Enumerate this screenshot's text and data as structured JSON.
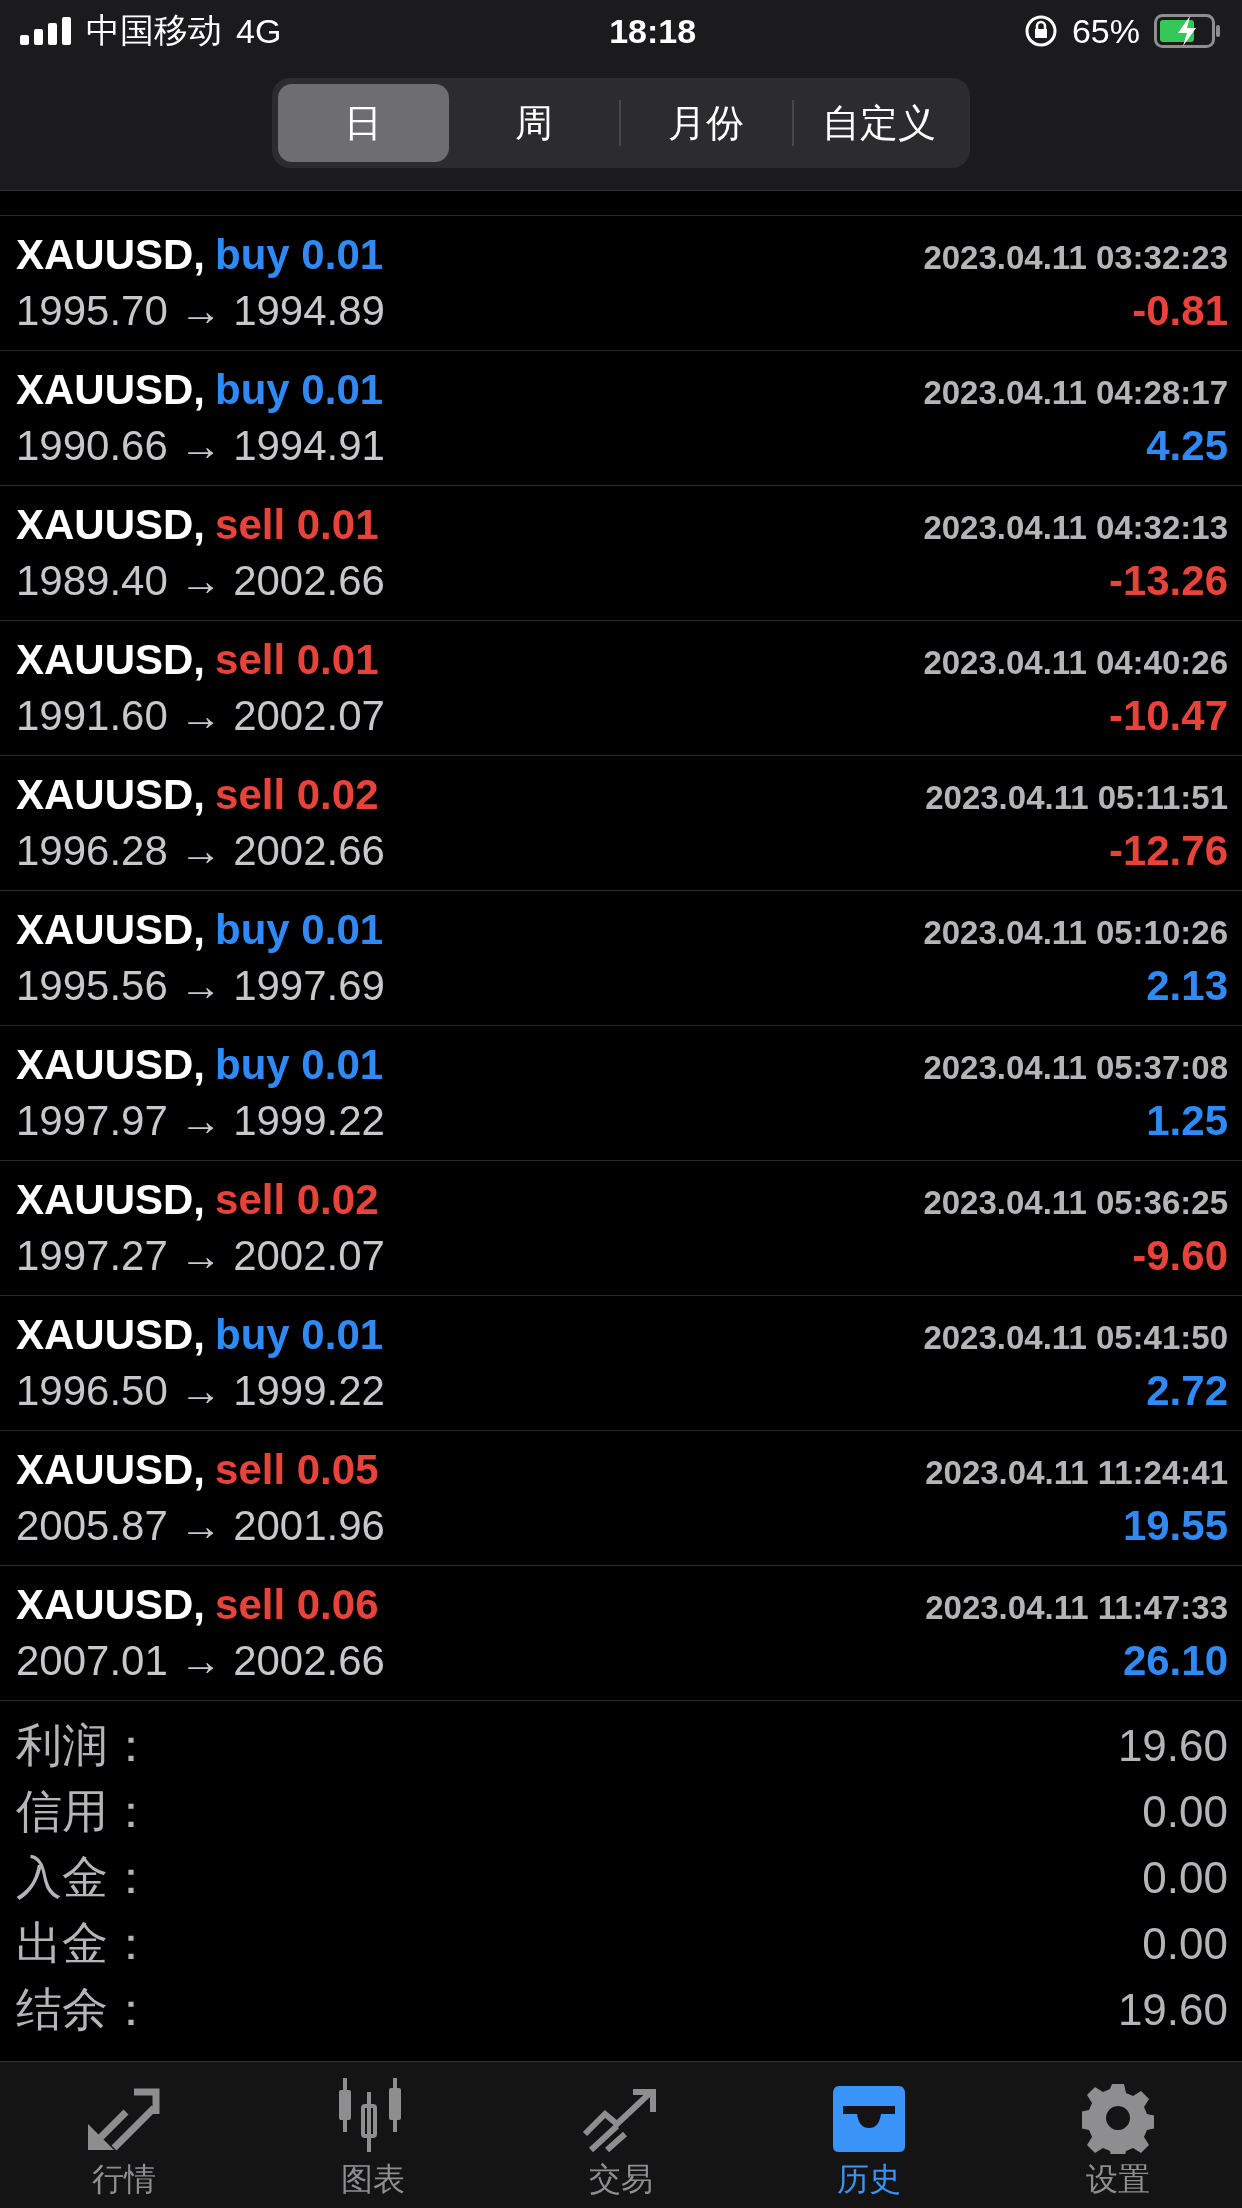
{
  "status_bar": {
    "carrier": "中国移动",
    "network": "4G",
    "time": "18:18",
    "battery": "65%"
  },
  "period_tabs": [
    {
      "label": "日",
      "selected": true
    },
    {
      "label": "周",
      "selected": false
    },
    {
      "label": "月份",
      "selected": false
    },
    {
      "label": "自定义",
      "selected": false
    }
  ],
  "deals": [
    {
      "symbol": "XAUUSD,",
      "kind": "buy",
      "order": "buy 0.01",
      "time": "2023.04.11 03:32:23",
      "prices": "1995.70 → 1994.89",
      "profit": {
        "text": "-0.81",
        "kind": "loss"
      }
    },
    {
      "symbol": "XAUUSD,",
      "kind": "buy",
      "order": "buy 0.01",
      "time": "2023.04.11 04:28:17",
      "prices": "1990.66 → 1994.91",
      "profit": {
        "text": "4.25",
        "kind": "gain"
      }
    },
    {
      "symbol": "XAUUSD,",
      "kind": "sell",
      "order": "sell 0.01",
      "time": "2023.04.11 04:32:13",
      "prices": "1989.40 → 2002.66",
      "profit": {
        "text": "-13.26",
        "kind": "loss"
      }
    },
    {
      "symbol": "XAUUSD,",
      "kind": "sell",
      "order": "sell 0.01",
      "time": "2023.04.11 04:40:26",
      "prices": "1991.60 → 2002.07",
      "profit": {
        "text": "-10.47",
        "kind": "loss"
      }
    },
    {
      "symbol": "XAUUSD,",
      "kind": "sell",
      "order": "sell 0.02",
      "time": "2023.04.11 05:11:51",
      "prices": "1996.28 → 2002.66",
      "profit": {
        "text": "-12.76",
        "kind": "loss"
      }
    },
    {
      "symbol": "XAUUSD,",
      "kind": "buy",
      "order": "buy 0.01",
      "time": "2023.04.11 05:10:26",
      "prices": "1995.56 → 1997.69",
      "profit": {
        "text": "2.13",
        "kind": "gain"
      }
    },
    {
      "symbol": "XAUUSD,",
      "kind": "buy",
      "order": "buy 0.01",
      "time": "2023.04.11 05:37:08",
      "prices": "1997.97 → 1999.22",
      "profit": {
        "text": "1.25",
        "kind": "gain"
      }
    },
    {
      "symbol": "XAUUSD,",
      "kind": "sell",
      "order": "sell 0.02",
      "time": "2023.04.11 05:36:25",
      "prices": "1997.27 → 2002.07",
      "profit": {
        "text": "-9.60",
        "kind": "loss"
      }
    },
    {
      "symbol": "XAUUSD,",
      "kind": "buy",
      "order": "buy 0.01",
      "time": "2023.04.11 05:41:50",
      "prices": "1996.50 → 1999.22",
      "profit": {
        "text": "2.72",
        "kind": "gain"
      }
    },
    {
      "symbol": "XAUUSD,",
      "kind": "sell",
      "order": "sell 0.05",
      "time": "2023.04.11 11:24:41",
      "prices": "2005.87 → 2001.96",
      "profit": {
        "text": "19.55",
        "kind": "gain"
      }
    },
    {
      "symbol": "XAUUSD,",
      "kind": "sell",
      "order": "sell 0.06",
      "time": "2023.04.11 11:47:33",
      "prices": "2007.01 → 2002.66",
      "profit": {
        "text": "26.10",
        "kind": "gain"
      }
    }
  ],
  "summary": [
    {
      "label": "利润：",
      "value": "19.60"
    },
    {
      "label": "信用：",
      "value": "0.00"
    },
    {
      "label": "入金：",
      "value": "0.00"
    },
    {
      "label": "出金：",
      "value": "0.00"
    },
    {
      "label": "结余：",
      "value": "19.60"
    }
  ],
  "tab_bar": [
    {
      "kind": "quotes",
      "label": "行情",
      "selected": false
    },
    {
      "kind": "chart",
      "label": "图表",
      "selected": false
    },
    {
      "kind": "trade",
      "label": "交易",
      "selected": false
    },
    {
      "kind": "history",
      "label": "历史",
      "selected": true
    },
    {
      "kind": "settings",
      "label": "设置",
      "selected": false
    }
  ]
}
